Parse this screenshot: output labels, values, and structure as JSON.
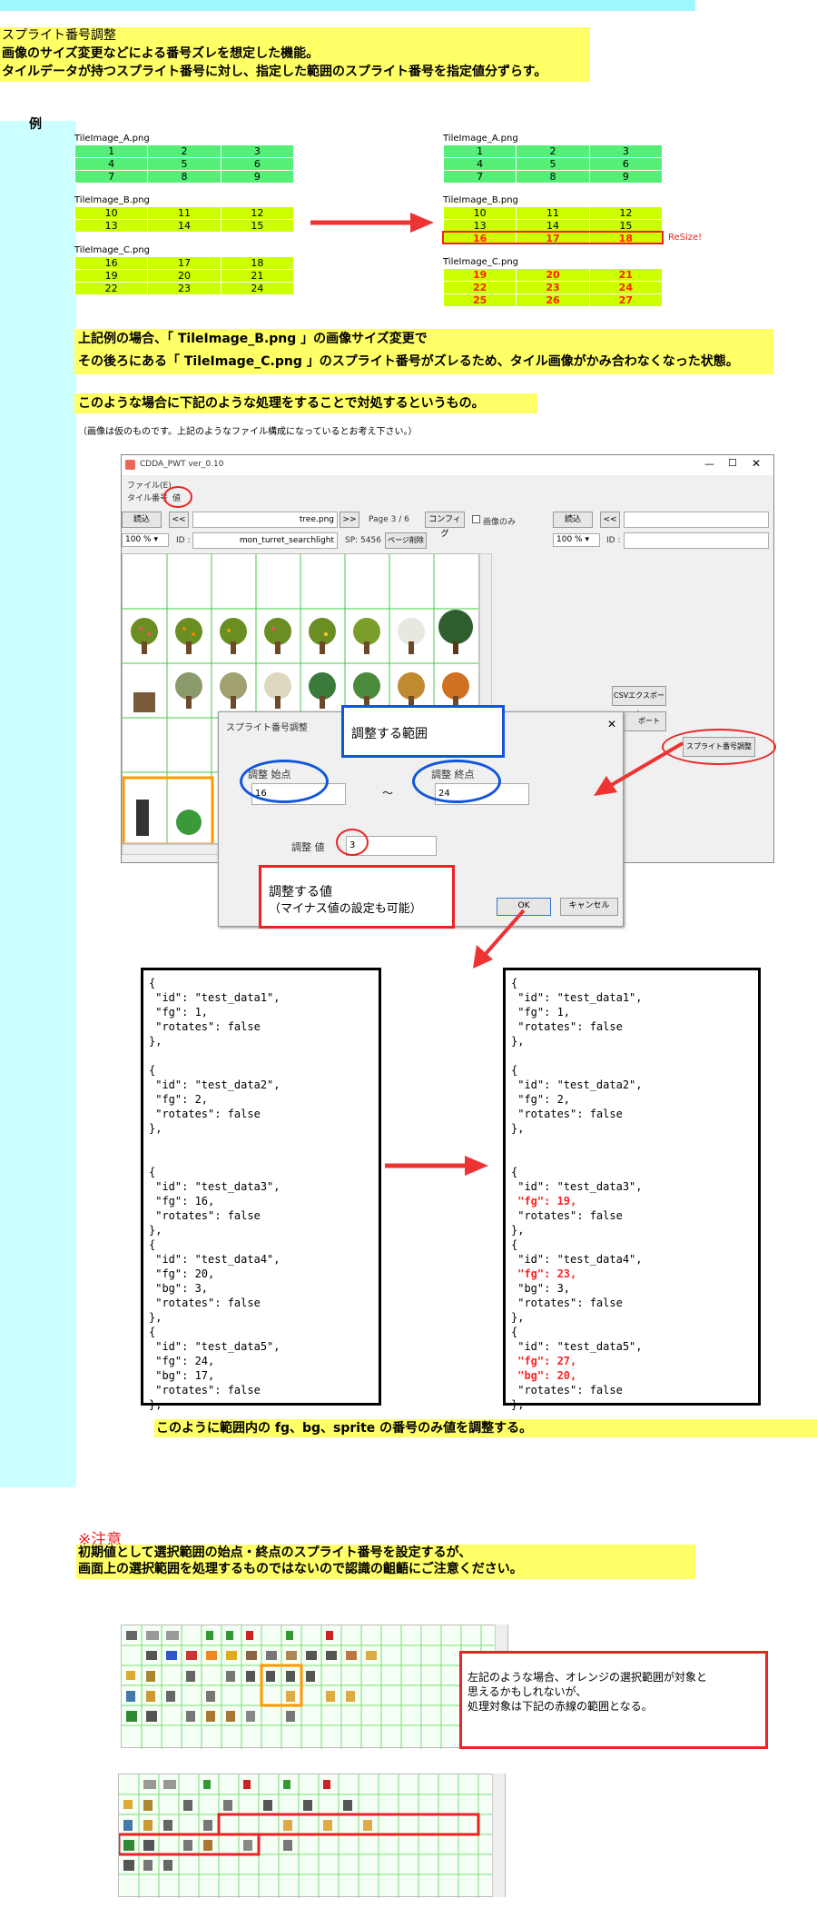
{
  "header": {
    "title": "スプライト番号調整",
    "line1": "画像のサイズ変更などによる番号ズレを想定した機能。",
    "line2": "タイルデータが持つスプライト番号に対し、指定した範囲のスプライト番号を指定値分ずらす。"
  },
  "example_label": "例",
  "left_tables": [
    {
      "name": "TileImage_A.png",
      "rows": [
        [
          "1",
          "2",
          "3"
        ],
        [
          "4",
          "5",
          "6"
        ],
        [
          "7",
          "8",
          "9"
        ]
      ]
    },
    {
      "name": "TileImage_B.png",
      "rows": [
        [
          "10",
          "11",
          "12"
        ],
        [
          "13",
          "14",
          "15"
        ]
      ]
    },
    {
      "name": "TileImage_C.png",
      "rows": [
        [
          "16",
          "17",
          "18"
        ],
        [
          "19",
          "20",
          "21"
        ],
        [
          "22",
          "23",
          "24"
        ]
      ]
    }
  ],
  "right_tables": [
    {
      "name": "TileImage_A.png",
      "rows": [
        [
          "1",
          "2",
          "3"
        ],
        [
          "4",
          "5",
          "6"
        ],
        [
          "7",
          "8",
          "9"
        ]
      ]
    },
    {
      "name": "TileImage_B.png",
      "rows": [
        [
          "10",
          "11",
          "12"
        ],
        [
          "13",
          "14",
          "15"
        ],
        [
          "16",
          "17",
          "18"
        ]
      ]
    },
    {
      "name": "TileImage_C.png",
      "rows": [
        [
          "19",
          "20",
          "21"
        ],
        [
          "22",
          "23",
          "24"
        ],
        [
          "25",
          "26",
          "27"
        ]
      ]
    }
  ],
  "resize_label": "ReSize!",
  "explain": {
    "line1": "上記例の場合、「 TileImage_B.png 」の画像サイズ変更で",
    "line2": "その後ろにある「 TileImage_C.png 」のスプライト番号がズレるため、タイル画像がかみ合わなくなった状態。",
    "line3": "このような場合に下記のような処理をすることで対処するというもの。",
    "note": "（画像は仮のものです。上記のようなファイル構成になっているとお考え下さい。）"
  },
  "app": {
    "window_title": "CDDA_PWT  ver_0.10",
    "menu_file": "ファイル(E)",
    "tile_select_label": "タイル番号",
    "tile_select_value": "値",
    "read_button": "読込",
    "prev_button": "<<",
    "next_button": ">>",
    "filename": "tree.png",
    "page": "Page 3 / 6",
    "config_button": "コンフィグ",
    "image_only": "画像のみ",
    "read_button_2": "読込",
    "prev_button_2": "<<",
    "zoom": "100 %",
    "zoom_2": "100 %",
    "id_label": "ID :",
    "id_label_2": "ID :",
    "id_value": "mon_turret_searchlight",
    "sp_label": "SP: 5456",
    "page_delete_button": "ページ削除",
    "csv_export_button": "CSVエクスポート",
    "export_button": "ポート",
    "sprite_adjust_button": "スプライト番号調整"
  },
  "dialog": {
    "title": "スプライト番号調整",
    "start_label": "調整  始点",
    "start_value": "16",
    "tilde": "～",
    "end_label": "調整  終点",
    "end_value": "24",
    "adjust_label": "調整  値",
    "adjust_value": "3",
    "ok_button": "OK",
    "cancel_button": "キャンセル",
    "close_icon": "✕"
  },
  "callouts": {
    "range": "調整する範囲",
    "value_title": "調整する値",
    "value_note": "（マイナス値の設定も可能）"
  },
  "json_before": "{\n \"id\": \"test_data1\",\n \"fg\": 1,\n \"rotates\": false\n},\n\n{\n \"id\": \"test_data2\",\n \"fg\": 2,\n \"rotates\": false\n},\n\n\n{\n \"id\": \"test_data3\",\n \"fg\": 16,\n \"rotates\": false\n},\n{\n \"id\": \"test_data4\",\n \"fg\": 20,\n \"bg\": 3,\n \"rotates\": false\n},\n{\n \"id\": \"test_data5\",\n \"fg\": 24,\n \"bg\": 17,\n \"rotates\": false\n},",
  "json_after": {
    "p1": "{\n \"id\": \"test_data1\",\n \"fg\": 1,\n \"rotates\": false\n},\n\n{\n \"id\": \"test_data2\",\n \"fg\": 2,\n \"rotates\": false\n},\n\n\n{\n \"id\": \"test_data3\",",
    "h1": "\n \"fg\": 19,",
    "p2": "\n \"rotates\": false\n},\n{\n \"id\": \"test_data4\",",
    "h2": "\n \"fg\": 23,",
    "p3": "\n \"bg\": 3,\n \"rotates\": false\n},\n{\n \"id\": \"test_data5\",",
    "h3": "\n \"fg\": 27,\n \"bg\": 20,",
    "p4": "\n \"rotates\": false\n},"
  },
  "summary": "このように範囲内の fg、bg、sprite の番号のみ値を調整する。",
  "caution": {
    "title": "※注意",
    "line1": "初期値として選択範囲の始点・終点のスプライト番号を設定するが、",
    "line2": "画面上の選択範囲を処理するものではないので認識の齟齬にご注意ください。",
    "callout": "左記のような場合、オレンジの選択範囲が対象と\n思えるかもしれないが、\n処理対象は下記の赤線の範囲となる。"
  },
  "colors": {
    "green": "#55ee77",
    "lime": "#ccff00",
    "yellow": "#ffff66",
    "cyan": "#ccffff",
    "red": "#ee2222",
    "blue": "#1155dd",
    "orange": "#ff9900"
  }
}
